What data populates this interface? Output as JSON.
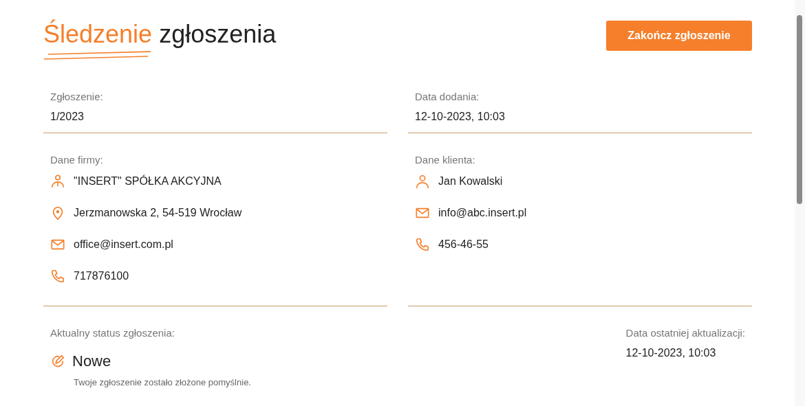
{
  "header": {
    "title_accent": "Śledzenie",
    "title_rest": "zgłoszenia",
    "button": "Zakończ zgłoszenie"
  },
  "sections": [
    {
      "columns": [
        {
          "label": "Zgłoszenie:",
          "value": "1/2023"
        },
        {
          "label": "Data dodania:",
          "value": "12-10-2023, 10:03"
        }
      ]
    },
    {
      "columns": [
        {
          "label": "Dane firmy:",
          "items": [
            {
              "kind": "company",
              "text": "\"INSERT\" SPÓŁKA AKCYJNA"
            },
            {
              "kind": "location",
              "text": "Jerzmanowska 2, 54-519 Wrocław"
            },
            {
              "kind": "email",
              "text": "office@insert.com.pl"
            },
            {
              "kind": "phone",
              "text": "717876100"
            }
          ]
        },
        {
          "label": "Dane klienta:",
          "items": [
            {
              "kind": "person",
              "text": "Jan Kowalski"
            },
            {
              "kind": "email",
              "text": "info@abc.insert.pl"
            },
            {
              "kind": "phone",
              "text": "456-46-55"
            }
          ]
        }
      ]
    }
  ],
  "status": {
    "label": "Aktualny status zgłoszenia:",
    "name": "Nowe",
    "description": "Twoje zgłoszenie zostało złożone pomyślnie.",
    "updated_label": "Data ostatniej aktualizacji:",
    "updated_value": "12-10-2023, 10:03"
  }
}
